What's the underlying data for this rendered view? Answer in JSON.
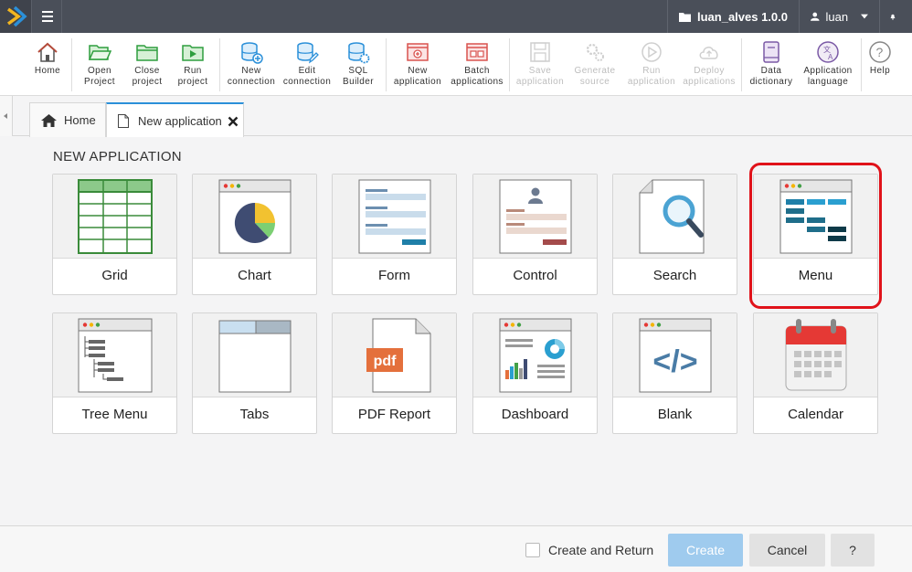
{
  "topbar": {
    "project_label": "luan_alves 1.0.0",
    "user_label": "luan"
  },
  "toolbar": {
    "home": {
      "line1": "Home",
      "line2": ""
    },
    "open_project": {
      "line1": "Open",
      "line2": "Project"
    },
    "close_project": {
      "line1": "Close",
      "line2": "project"
    },
    "run_project": {
      "line1": "Run",
      "line2": "project"
    },
    "new_connection": {
      "line1": "New",
      "line2": "connection"
    },
    "edit_connection": {
      "line1": "Edit",
      "line2": "connection"
    },
    "sql_builder": {
      "line1": "SQL",
      "line2": "Builder"
    },
    "new_application": {
      "line1": "New",
      "line2": "application"
    },
    "batch_applications": {
      "line1": "Batch",
      "line2": "applications"
    },
    "save_application": {
      "line1": "Save",
      "line2": "application"
    },
    "generate_source": {
      "line1": "Generate",
      "line2": "source"
    },
    "run_application": {
      "line1": "Run",
      "line2": "application"
    },
    "deploy_applications": {
      "line1": "Deploy",
      "line2": "applications"
    },
    "data_dictionary": {
      "line1": "Data",
      "line2": "dictionary"
    },
    "application_language": {
      "line1": "Application",
      "line2": "language"
    },
    "help": {
      "line1": "Help",
      "line2": ""
    }
  },
  "tabs": [
    {
      "label": "Home"
    },
    {
      "label": "New application"
    }
  ],
  "page_title": "NEW APPLICATION",
  "app_types": [
    {
      "label": "Grid"
    },
    {
      "label": "Chart"
    },
    {
      "label": "Form"
    },
    {
      "label": "Control"
    },
    {
      "label": "Search"
    },
    {
      "label": "Menu"
    },
    {
      "label": "Tree Menu"
    },
    {
      "label": "Tabs"
    },
    {
      "label": "PDF Report"
    },
    {
      "label": "Dashboard"
    },
    {
      "label": "Blank"
    },
    {
      "label": "Calendar"
    }
  ],
  "pdf_badge": "pdf",
  "blank_code": "</>",
  "footer": {
    "create_return_label": "Create and Return",
    "create_label": "Create",
    "cancel_label": "Cancel",
    "help_label": "?"
  },
  "colors": {
    "topbar": "#4a4f59",
    "accent": "#2b90d9",
    "highlight": "#e0121a",
    "create_button": "#9fcbee"
  }
}
